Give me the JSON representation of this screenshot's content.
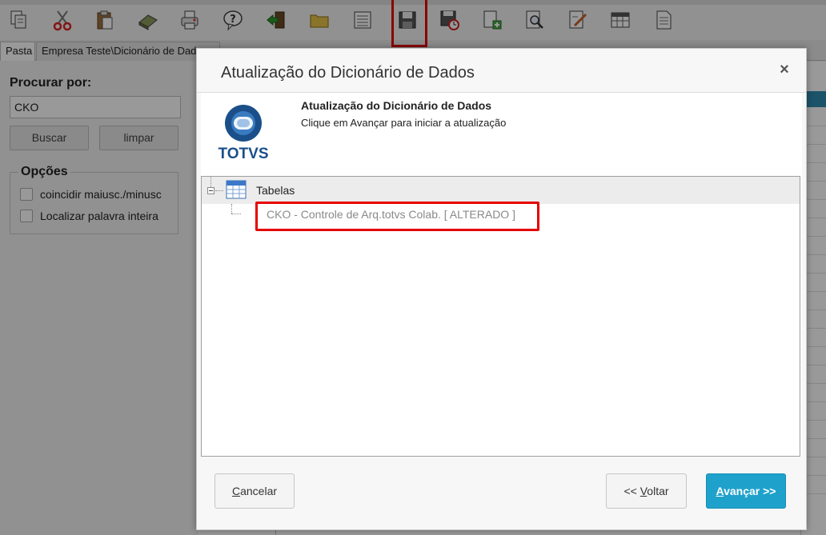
{
  "app": {
    "tabs": {
      "folder": "Pasta",
      "path": "Empresa Teste\\Dicionário de Dados"
    },
    "search": {
      "label": "Procurar por:",
      "value": "CKO",
      "search_button": "Buscar",
      "clear_button": "limpar"
    },
    "options": {
      "legend": "Opções",
      "match_case": "coincidir maiusc./minusc",
      "whole_word": "Localizar palavra inteira"
    },
    "toolbar_icons": [
      "copy-icon",
      "cut-icon",
      "paste-icon",
      "eraser-icon",
      "print-icon",
      "help-icon",
      "exit-icon",
      "folder-icon",
      "list-icon",
      "save-icon",
      "schedule-icon",
      "add-page-icon",
      "preview-icon",
      "edit-icon",
      "grid-icon",
      "document-icon"
    ]
  },
  "dialog": {
    "title": "Atualização do Dicionário de Dados",
    "close_glyph": "×",
    "logo_text": "TOTVS",
    "intro_title": "Atualização do Dicionário de Dados",
    "intro_subtitle": "Clique em Avançar para iniciar a atualização",
    "tree": {
      "root_label": "Tabelas",
      "child_label": "CKO - Controle de Arq.totvs Colab.  [ ALTERADO ]"
    },
    "buttons": {
      "cancel_hotkey": "C",
      "cancel_rest": "ancelar",
      "back_prefix": "<< ",
      "back_hotkey": "V",
      "back_rest": "oltar",
      "next_hotkey": "A",
      "next_rest": "vançar >>"
    }
  },
  "colors": {
    "accent": "#1ea2cc",
    "highlight": "#e60000",
    "logo_blue": "#1a4f8a"
  }
}
